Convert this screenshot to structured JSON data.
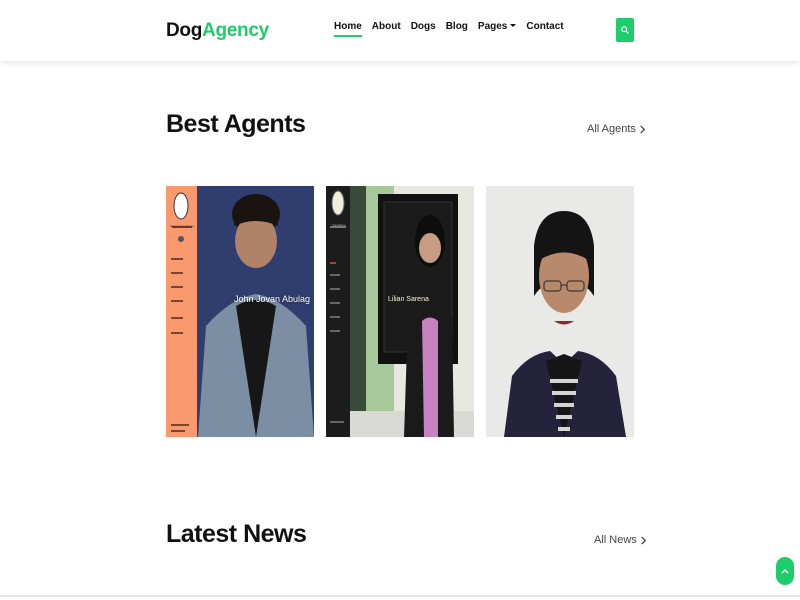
{
  "brand": {
    "part1": "Dog",
    "part2": "Agency"
  },
  "nav": {
    "items": [
      {
        "label": "Home",
        "active": true
      },
      {
        "label": "About"
      },
      {
        "label": "Dogs"
      },
      {
        "label": "Blog"
      },
      {
        "label": "Pages",
        "dropdown": true
      },
      {
        "label": "Contact"
      }
    ]
  },
  "icons": {
    "search": "search-icon",
    "chevron": "chevron-right-icon",
    "scroll_top": "chevron-up-icon"
  },
  "colors": {
    "accent": "#1ecc6a",
    "text": "#111111",
    "card1_sidebar": "#f99a6e",
    "card2_sidebar": "#1c1c1c"
  },
  "agents_section": {
    "title": "Best Agents",
    "see_all": "All Agents"
  },
  "agents": [
    {
      "overlay_name": "John Jovan Abulag",
      "sidebar_name": "John Jovan Abulag"
    },
    {
      "overlay_name": "Lilian Sarena",
      "sidebar_name": "Samjlame"
    },
    {
      "overlay_name": ""
    }
  ],
  "news_section": {
    "title": "Latest News",
    "see_all": "All News"
  }
}
